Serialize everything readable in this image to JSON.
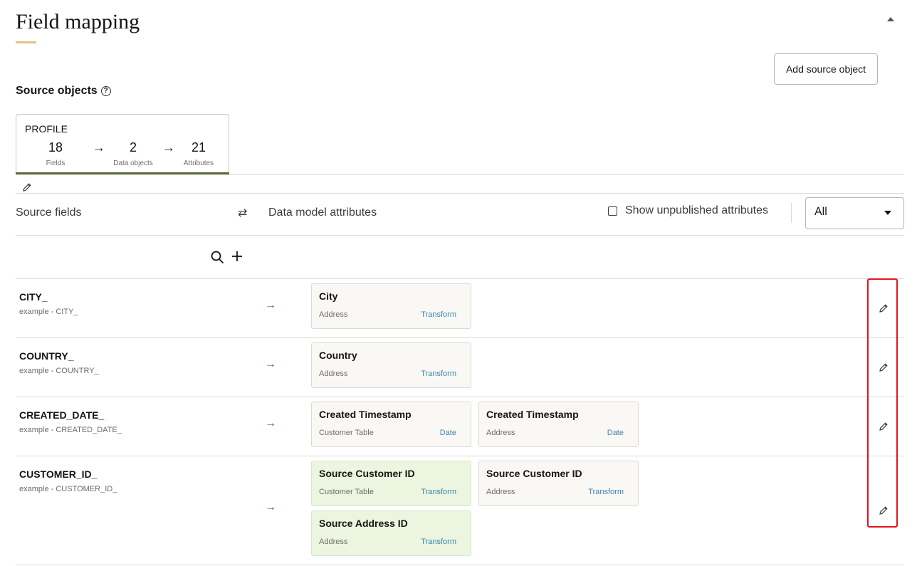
{
  "header": {
    "title": "Field mapping",
    "add_source_label": "Add source object"
  },
  "source_objects": {
    "label": "Source objects",
    "help_glyph": "?",
    "card": {
      "name": "PROFILE",
      "fields_count": "18",
      "fields_label": "Fields",
      "data_objects_count": "2",
      "data_objects_label": "Data objects",
      "attributes_count": "21",
      "attributes_label": "Attributes"
    }
  },
  "columns": {
    "source_fields": "Source fields",
    "data_model_attributes": "Data model attributes",
    "show_unpublished": "Show unpublished attributes",
    "filter_value": "All"
  },
  "rows": [
    {
      "field": "CITY_",
      "example": "example - CITY_",
      "attributes": [
        {
          "name": "City",
          "object": "Address",
          "type": "Transform",
          "highlight": false
        }
      ]
    },
    {
      "field": "COUNTRY_",
      "example": "example - COUNTRY_",
      "attributes": [
        {
          "name": "Country",
          "object": "Address",
          "type": "Transform",
          "highlight": false
        }
      ]
    },
    {
      "field": "CREATED_DATE_",
      "example": "example - CREATED_DATE_",
      "attributes": [
        {
          "name": "Created Timestamp",
          "object": "Customer Table",
          "type": "Date",
          "highlight": false
        },
        {
          "name": "Created Timestamp",
          "object": "Address",
          "type": "Date",
          "highlight": false
        }
      ]
    },
    {
      "field": "CUSTOMER_ID_",
      "example": "example - CUSTOMER_ID_",
      "attributes": [
        {
          "name": "Source Customer ID",
          "object": "Customer Table",
          "type": "Transform",
          "highlight": true
        },
        {
          "name": "Source Customer ID",
          "object": "Address",
          "type": "Transform",
          "highlight": false
        },
        {
          "name": "Source Address ID",
          "object": "Address",
          "type": "Transform",
          "highlight": true
        }
      ]
    }
  ],
  "icons": {
    "collapse": "chevron-up-icon",
    "edit": "pencil-icon",
    "swap": "swap-icon",
    "search": "search-icon",
    "add": "plus-icon",
    "map_arrow": "arrow-right-icon"
  },
  "colors": {
    "accent_underline": "#e4c082",
    "card_underline": "#5b6e3d",
    "map_arrow": "#3a7a32",
    "type_link": "#3d87a8",
    "highlight_attr": "#ecf5e0",
    "annotation_box": "#e0161d"
  }
}
